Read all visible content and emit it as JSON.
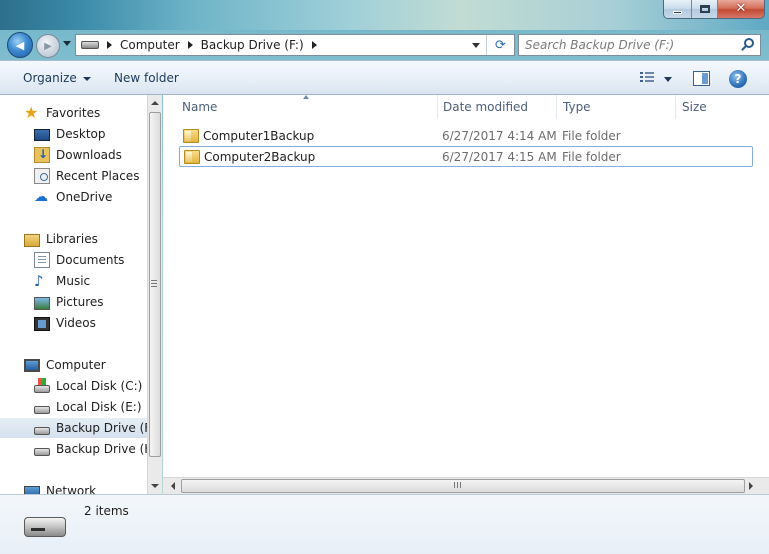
{
  "window": {
    "close_glyph": "✕",
    "minimize_label": "",
    "maximize_label": ""
  },
  "navigation": {
    "back_glyph": "◀",
    "forward_glyph": "▶",
    "breadcrumbs": [
      "Computer",
      "Backup Drive (F:)"
    ],
    "refresh_glyph": "⟳"
  },
  "search": {
    "placeholder": "Search Backup Drive (F:)"
  },
  "toolbar": {
    "organize_label": "Organize",
    "new_folder_label": "New folder",
    "help_glyph": "?"
  },
  "sidebar": {
    "favorites": {
      "label": "Favorites",
      "items": [
        {
          "label": "Desktop",
          "icon": "desktop-icon"
        },
        {
          "label": "Downloads",
          "icon": "downloads-icon"
        },
        {
          "label": "Recent Places",
          "icon": "recent-places-icon"
        },
        {
          "label": "OneDrive",
          "icon": "onedrive-icon"
        }
      ]
    },
    "libraries": {
      "label": "Libraries",
      "items": [
        {
          "label": "Documents",
          "icon": "documents-icon"
        },
        {
          "label": "Music",
          "icon": "music-icon"
        },
        {
          "label": "Pictures",
          "icon": "pictures-icon"
        },
        {
          "label": "Videos",
          "icon": "videos-icon"
        }
      ]
    },
    "computer": {
      "label": "Computer",
      "items": [
        {
          "label": "Local Disk (C:)",
          "icon": "local-disk-icon"
        },
        {
          "label": "Local Disk (E:)",
          "icon": "local-disk-icon"
        },
        {
          "label": "Backup Drive (F:)",
          "icon": "removable-drive-icon",
          "selected": true
        },
        {
          "label": "Backup Drive (H:",
          "icon": "removable-drive-icon"
        }
      ]
    },
    "network": {
      "label": "Network"
    }
  },
  "file_list": {
    "columns": [
      "Name",
      "Date modified",
      "Type",
      "Size"
    ],
    "sorted_by": "Name",
    "rows": [
      {
        "name": "Computer1Backup",
        "date_modified": "6/27/2017 4:14 AM",
        "type": "File folder",
        "size": ""
      },
      {
        "name": "Computer2Backup",
        "date_modified": "6/27/2017 4:15 AM",
        "type": "File folder",
        "size": "",
        "focused": true
      }
    ]
  },
  "details_pane": {
    "item_count": "2 items"
  },
  "colors": {
    "accent": "#1e395b",
    "selection_border": "#84acdd"
  }
}
